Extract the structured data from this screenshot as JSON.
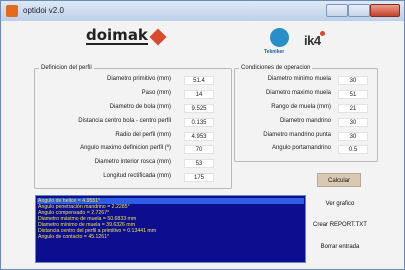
{
  "window": {
    "title": "optidoi v2.0"
  },
  "logos": {
    "left": "doimak",
    "tekniker": "Tekniker",
    "right": "ik4"
  },
  "groups": {
    "perfil": {
      "title": "Definicion del perfil",
      "fields": [
        {
          "label": "Diametro primitivo (mm)",
          "value": "51.4"
        },
        {
          "label": "Paso (mm)",
          "value": "14"
        },
        {
          "label": "Diametro de bola (mm)",
          "value": "9.525"
        },
        {
          "label": "Distancia centro bola - centro perfil",
          "value": "0.135"
        },
        {
          "label": "Radio del perfil (mm)",
          "value": "4.953"
        },
        {
          "label": "Angulo maximo definicion perfil (º)",
          "value": "70"
        },
        {
          "label": "Diametro interior rosca (mm)",
          "value": "53"
        },
        {
          "label": "Longitud rectificada (mm)",
          "value": "175"
        }
      ]
    },
    "operacion": {
      "title": "Condiciones de operacion",
      "fields": [
        {
          "label": "Diametro minimo muela",
          "value": "30"
        },
        {
          "label": "Diametro maximo muela",
          "value": "51"
        },
        {
          "label": "Rango de muela (mm)",
          "value": "21"
        },
        {
          "label": "Diametro mandrino",
          "value": "30"
        },
        {
          "label": "Diametro mandrino punta",
          "value": "30"
        },
        {
          "label": "Angulo portamandrino",
          "value": "0.5"
        }
      ]
    }
  },
  "buttons": {
    "calcular": "Calcular",
    "ver_grafico": "Ver grafico",
    "crear_report": "Crear REPORT.TXT",
    "borrar": "Borrar entrada"
  },
  "output_lines": [
    "Angulo de helice = 4.9551°",
    "Angulo penetración mandrino = 2.2285°",
    "Angulo compensado = 2.7267°",
    "Diametro máximo de muela = 50.6833 mm",
    "Diametro mínimo de muela = 39.6326 mm",
    "Distancia centro del perfil a primitivo = 0.13441 mm",
    "Angulo de contacto = 45.1261°"
  ]
}
